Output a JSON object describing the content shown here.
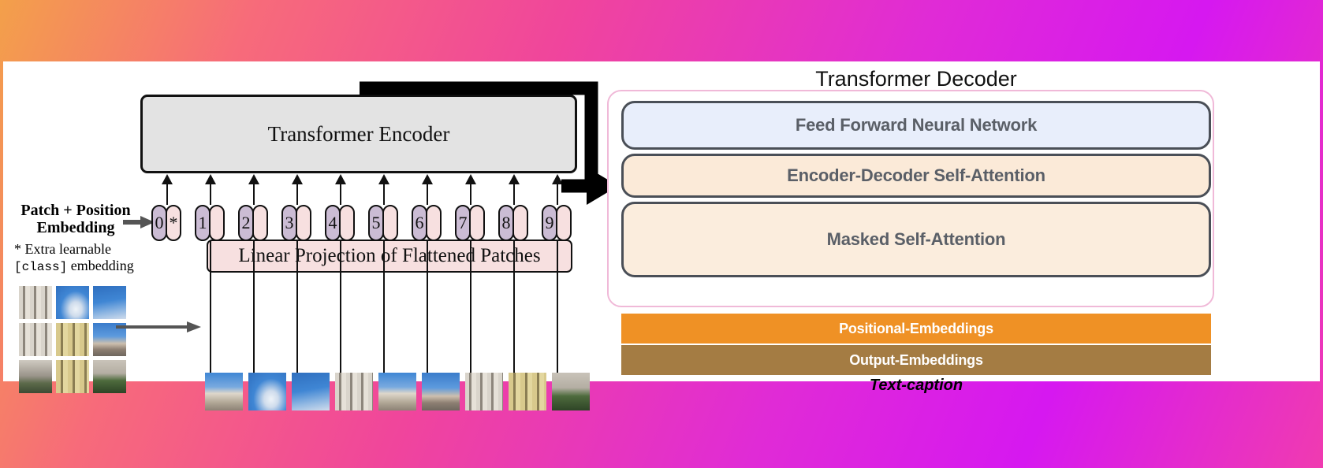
{
  "background": {
    "gradient_from": "#f3a04a",
    "gradient_mid": "#f0459c",
    "gradient_to": "#d618f0"
  },
  "encoder": {
    "title": "Transformer Encoder",
    "linear_projection": "Linear Projection of Flattened Patches",
    "patch_position_label_line1": "Patch + Position",
    "patch_position_label_line2": "Embedding",
    "extra_note_line1": "* Extra learnable",
    "extra_note_mono": "[class]",
    "extra_note_line2": " embedding",
    "tokens": [
      {
        "pos": "0",
        "patch": "*"
      },
      {
        "pos": "1",
        "patch": ""
      },
      {
        "pos": "2",
        "patch": ""
      },
      {
        "pos": "3",
        "patch": ""
      },
      {
        "pos": "4",
        "patch": ""
      },
      {
        "pos": "5",
        "patch": ""
      },
      {
        "pos": "6",
        "patch": ""
      },
      {
        "pos": "7",
        "patch": ""
      },
      {
        "pos": "8",
        "patch": ""
      },
      {
        "pos": "9",
        "patch": ""
      }
    ],
    "colors": {
      "encoder_box": "#e3e3e3",
      "linear_projection_box": "#f7e0e0",
      "position_token": "#cbbcd4",
      "patch_token": "#f7e0e0"
    }
  },
  "decoder": {
    "title": "Transformer Decoder",
    "rows": [
      {
        "label": "Feed Forward Neural Network",
        "color": "#e8eefb"
      },
      {
        "label": "Encoder-Decoder Self-Attention",
        "color": "#fbead8"
      },
      {
        "label": "Masked Self-Attention",
        "color": "#fbeddd"
      }
    ],
    "embeddings": [
      {
        "label": "Positional-Embeddings",
        "color": "#ef9125"
      },
      {
        "label": "Output-Embeddings",
        "color": "#a47c43"
      }
    ],
    "caption": "Text-caption",
    "outline_color": "#f0b9d8"
  }
}
